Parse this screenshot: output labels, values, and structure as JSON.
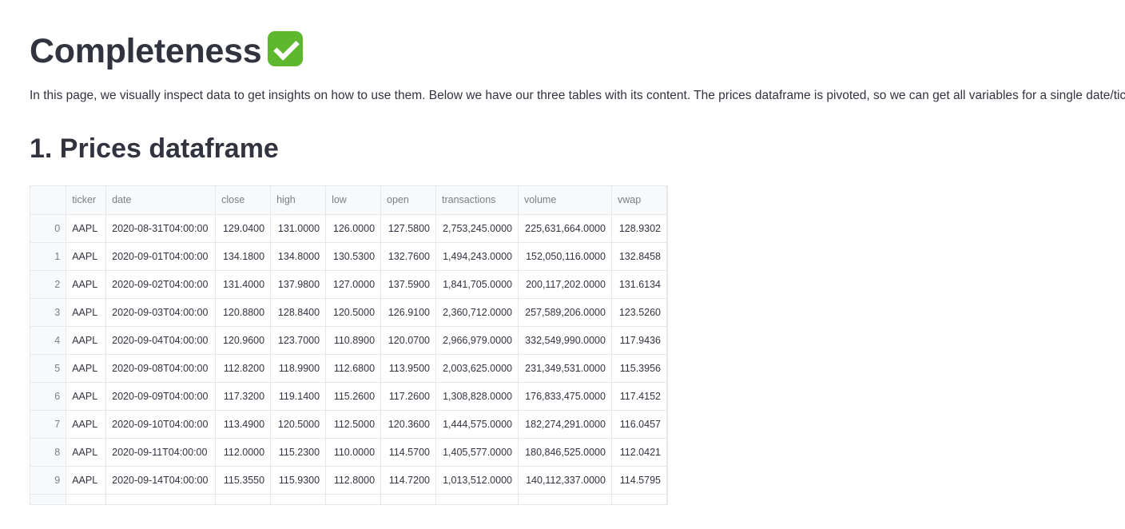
{
  "page": {
    "title": "Completeness",
    "title_emoji": "check-mark-button-icon",
    "intro": "In this page, we visually inspect data to get insights on how to use them. Below we have our three tables with its content. The prices dataframe is pivoted, so we can get all variables for a single date/ticker.",
    "section_title": "1. Prices dataframe"
  },
  "table": {
    "columns": [
      "",
      "ticker",
      "date",
      "close",
      "high",
      "low",
      "open",
      "transactions",
      "volume",
      "vwap"
    ],
    "rows": [
      [
        "0",
        "AAPL",
        "2020-08-31T04:00:00",
        "129.0400",
        "131.0000",
        "126.0000",
        "127.5800",
        "2,753,245.0000",
        "225,631,664.0000",
        "128.9302"
      ],
      [
        "1",
        "AAPL",
        "2020-09-01T04:00:00",
        "134.1800",
        "134.8000",
        "130.5300",
        "132.7600",
        "1,494,243.0000",
        "152,050,116.0000",
        "132.8458"
      ],
      [
        "2",
        "AAPL",
        "2020-09-02T04:00:00",
        "131.4000",
        "137.9800",
        "127.0000",
        "137.5900",
        "1,841,705.0000",
        "200,117,202.0000",
        "131.6134"
      ],
      [
        "3",
        "AAPL",
        "2020-09-03T04:00:00",
        "120.8800",
        "128.8400",
        "120.5000",
        "126.9100",
        "2,360,712.0000",
        "257,589,206.0000",
        "123.5260"
      ],
      [
        "4",
        "AAPL",
        "2020-09-04T04:00:00",
        "120.9600",
        "123.7000",
        "110.8900",
        "120.0700",
        "2,966,979.0000",
        "332,549,990.0000",
        "117.9436"
      ],
      [
        "5",
        "AAPL",
        "2020-09-08T04:00:00",
        "112.8200",
        "118.9900",
        "112.6800",
        "113.9500",
        "2,003,625.0000",
        "231,349,531.0000",
        "115.3956"
      ],
      [
        "6",
        "AAPL",
        "2020-09-09T04:00:00",
        "117.3200",
        "119.1400",
        "115.2600",
        "117.2600",
        "1,308,828.0000",
        "176,833,475.0000",
        "117.4152"
      ],
      [
        "7",
        "AAPL",
        "2020-09-10T04:00:00",
        "113.4900",
        "120.5000",
        "112.5000",
        "120.3600",
        "1,444,575.0000",
        "182,274,291.0000",
        "116.0457"
      ],
      [
        "8",
        "AAPL",
        "2020-09-11T04:00:00",
        "112.0000",
        "115.2300",
        "110.0000",
        "114.5700",
        "1,405,577.0000",
        "180,846,525.0000",
        "112.0421"
      ],
      [
        "9",
        "AAPL",
        "2020-09-14T04:00:00",
        "115.3550",
        "115.9300",
        "112.8000",
        "114.7200",
        "1,013,512.0000",
        "140,112,337.0000",
        "114.5795"
      ]
    ]
  }
}
